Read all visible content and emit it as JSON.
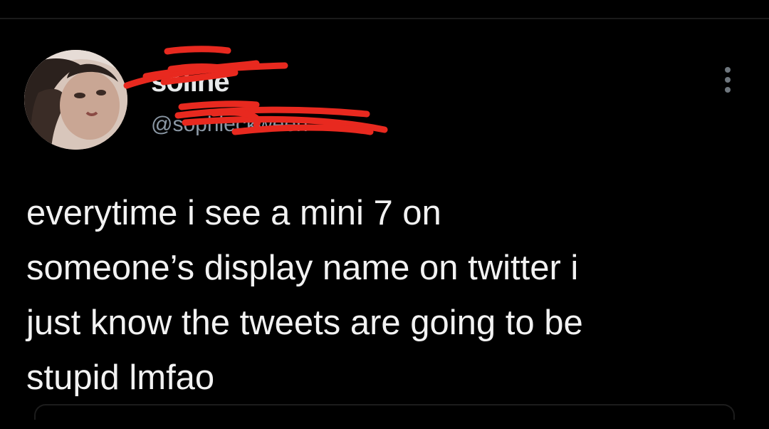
{
  "tweet": {
    "author": {
      "display_name": "soline",
      "handle": "@sophieckween",
      "avatar_icon": "profile-photo"
    },
    "text_lines": [
      "everytime i see a mini 7 on",
      "someone’s display name on twitter i",
      "just know the tweets are going to be",
      "stupid lmfao"
    ],
    "more_icon": "more-vertical-icon"
  },
  "colors": {
    "background": "#000000",
    "text": "#f2f2f2",
    "handle": "#8b98a5",
    "redaction": "#e8291f"
  }
}
